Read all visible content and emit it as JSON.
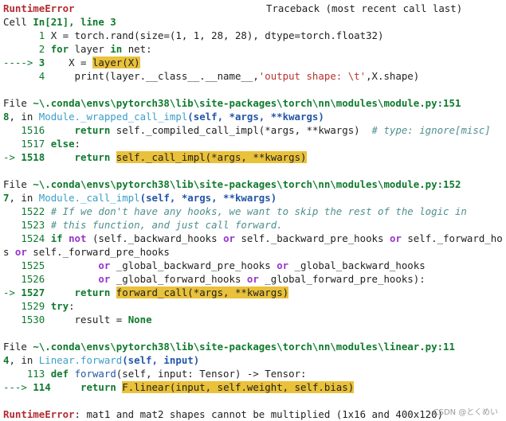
{
  "traceback": {
    "header_error": "RuntimeError",
    "header_title": "Traceback (most recent call last)",
    "cell_prefix": "Cell ",
    "cell_ref": "In[21], line 3",
    "cell_lines": [
      {
        "no": "1",
        "code": "X = torch.rand(size=(1, 1, 28, 28), dtype=torch.float32)"
      },
      {
        "no": "2",
        "code_kw": "for",
        "code": " layer ",
        "code_kw2": "in",
        "code2": " net:"
      },
      {
        "arrow": "---->",
        "no": "3",
        "code_pre": "    X = ",
        "code_hl": "layer(X)"
      },
      {
        "no": "4",
        "code_pre": "    print(layer.__class__.__name__,",
        "code_str": "'output shape: \\t'",
        "code_post": ",X.shape)"
      }
    ],
    "frame1": {
      "file_prefix": "File ",
      "path_line1": "~\\.conda\\envs\\pytorch38\\lib\\site-packages\\torch\\nn\\modules\\module.py:151",
      "path_line2": "8",
      "in_text": ", in ",
      "func": "Module._wrapped_call_impl",
      "args": "(self, *args, **kwargs)",
      "lines": [
        {
          "no": "1516",
          "kw": "return",
          "code": " self._compiled_call_impl(*args, **kwargs)  ",
          "comment": "# type: ignore[misc]"
        },
        {
          "no": "1517",
          "kw": "else",
          "code": ":"
        },
        {
          "arrow": "->",
          "no": "1518",
          "kw": "return",
          "hl": "self._call_impl(*args, **kwargs)"
        }
      ]
    },
    "frame2": {
      "file_prefix": "File ",
      "path_line1": "~\\.conda\\envs\\pytorch38\\lib\\site-packages\\torch\\nn\\modules\\module.py:152",
      "path_line2": "7",
      "in_text": ", in ",
      "func": "Module._call_impl",
      "args": "(self, *args, **kwargs)",
      "lines": [
        {
          "no": "1522",
          "comment": "# If we don't have any hooks, we want to skip the rest of the logic in"
        },
        {
          "no": "1523",
          "comment": "# this function, and just call forward."
        },
        {
          "no": "1524",
          "kw": "if",
          "kw2": "not",
          "code": " (self._backward_hooks ",
          "or1": "or",
          "code2": " self._backward_pre_hooks ",
          "or2": "or",
          "code3": " self._forward_hook"
        },
        {
          "cont_pre": "s ",
          "or": "or",
          "cont": " self._forward_pre_hooks"
        },
        {
          "no": "1525",
          "indent": "        ",
          "or": "or",
          "code": " _global_backward_pre_hooks ",
          "or2": "or",
          "code2": " _global_backward_hooks"
        },
        {
          "no": "1526",
          "indent": "        ",
          "or": "or",
          "code": " _global_forward_hooks ",
          "or2": "or",
          "code2": " _global_forward_pre_hooks):"
        },
        {
          "arrow": "->",
          "no": "1527",
          "kw": "return",
          "hl": "forward_call(*args, **kwargs)"
        },
        {
          "no": "1529",
          "kw": "try",
          "code": ":"
        },
        {
          "no": "1530",
          "code": "    result = ",
          "kw": "None"
        }
      ]
    },
    "frame3": {
      "file_prefix": "File ",
      "path_line1": "~\\.conda\\envs\\pytorch38\\lib\\site-packages\\torch\\nn\\modules\\linear.py:11",
      "path_line2": "4",
      "in_text": ", in ",
      "func": "Linear.forward",
      "args": "(self, input)",
      "lines": [
        {
          "no": "113",
          "kw": "def",
          "fname": "forward",
          "code": "(self, input: Tensor) -> Tensor:"
        },
        {
          "arrow": "--->",
          "no": "114",
          "kw": "return",
          "hl": "F.linear(input, self.weight, self.bias)"
        }
      ]
    },
    "final_error": "RuntimeError",
    "final_message": ": mat1 and mat2 shapes cannot be multiplied (1x16 and 400x120)"
  },
  "watermark": "CSDN @とくめい"
}
